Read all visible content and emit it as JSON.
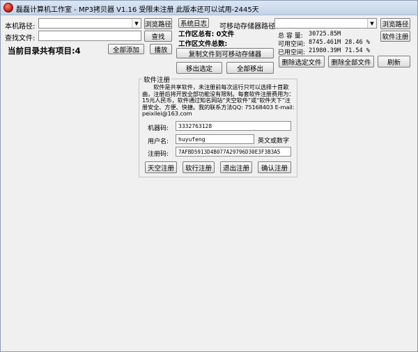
{
  "window": {
    "title": "磊磊计算机工作室 - MP3拷贝器 V1.16  受限未注册  此版本还可以试用-2445天",
    "app_icon": "app-icon"
  },
  "left": {
    "local_path_label": "本机路径:",
    "local_path_value": "",
    "browse_button": "浏览路径",
    "find_file_label": "查找文件:",
    "find_file_value": "",
    "find_button": "查找",
    "current_items": "当前目录共有项目:4",
    "add_all_button": "全部添加",
    "play_button": "播放"
  },
  "middle": {
    "system_log_button": "系统日志",
    "workspace_total": "工作区总有: 0文件",
    "workspace_size": "工作区文件总数:",
    "copy_button": "复制文件到可移动存储器",
    "remove_selected_button": "移出选定",
    "remove_all_button": "全部移出"
  },
  "right": {
    "removable_path_label": "可移动存储器路径:",
    "removable_path_value": "",
    "browse_button": "浏览路径",
    "register_button": "软件注册",
    "total_capacity_label": "总 容 量:",
    "total_capacity_value": "30725.85M",
    "free_space_label": "可用空间:",
    "free_space_value": "8745.461M",
    "free_space_pct": "28.46 %",
    "used_space_label": "已用空间:",
    "used_space_value": "21980.39M",
    "used_space_pct": "71.54 %",
    "delete_selected_button": "删除选定文件",
    "delete_all_button": "删除全部文件",
    "refresh_button": "刷新"
  },
  "register_dialog": {
    "group_title": "软件注册",
    "info_text": "　　软件是共享软件，未注册前每次运行只可以选择十首歌曲，注册后将开放全部功能没有限制。每套软件注册费用为：15元人民币，软件通过知名网站“天空软件”或“软件天下”注册安全、方便、快捷。我的联系方法QQ: 75168403 E-mail: peixilei@163.com",
    "machine_code_label": "机器码:",
    "machine_code_value": "3332763128",
    "username_label": "用户名:",
    "username_value": "huyufeng",
    "username_hint": "英文或数字",
    "reg_code_label": "注册码:",
    "reg_code_value": "7AFBD5913D4B077A29796D30E3F3B3A5",
    "sky_register_button": "天空注册",
    "softworld_register_button": "软行注册",
    "exit_register_button": "退出注册",
    "confirm_register_button": "确认注册"
  }
}
